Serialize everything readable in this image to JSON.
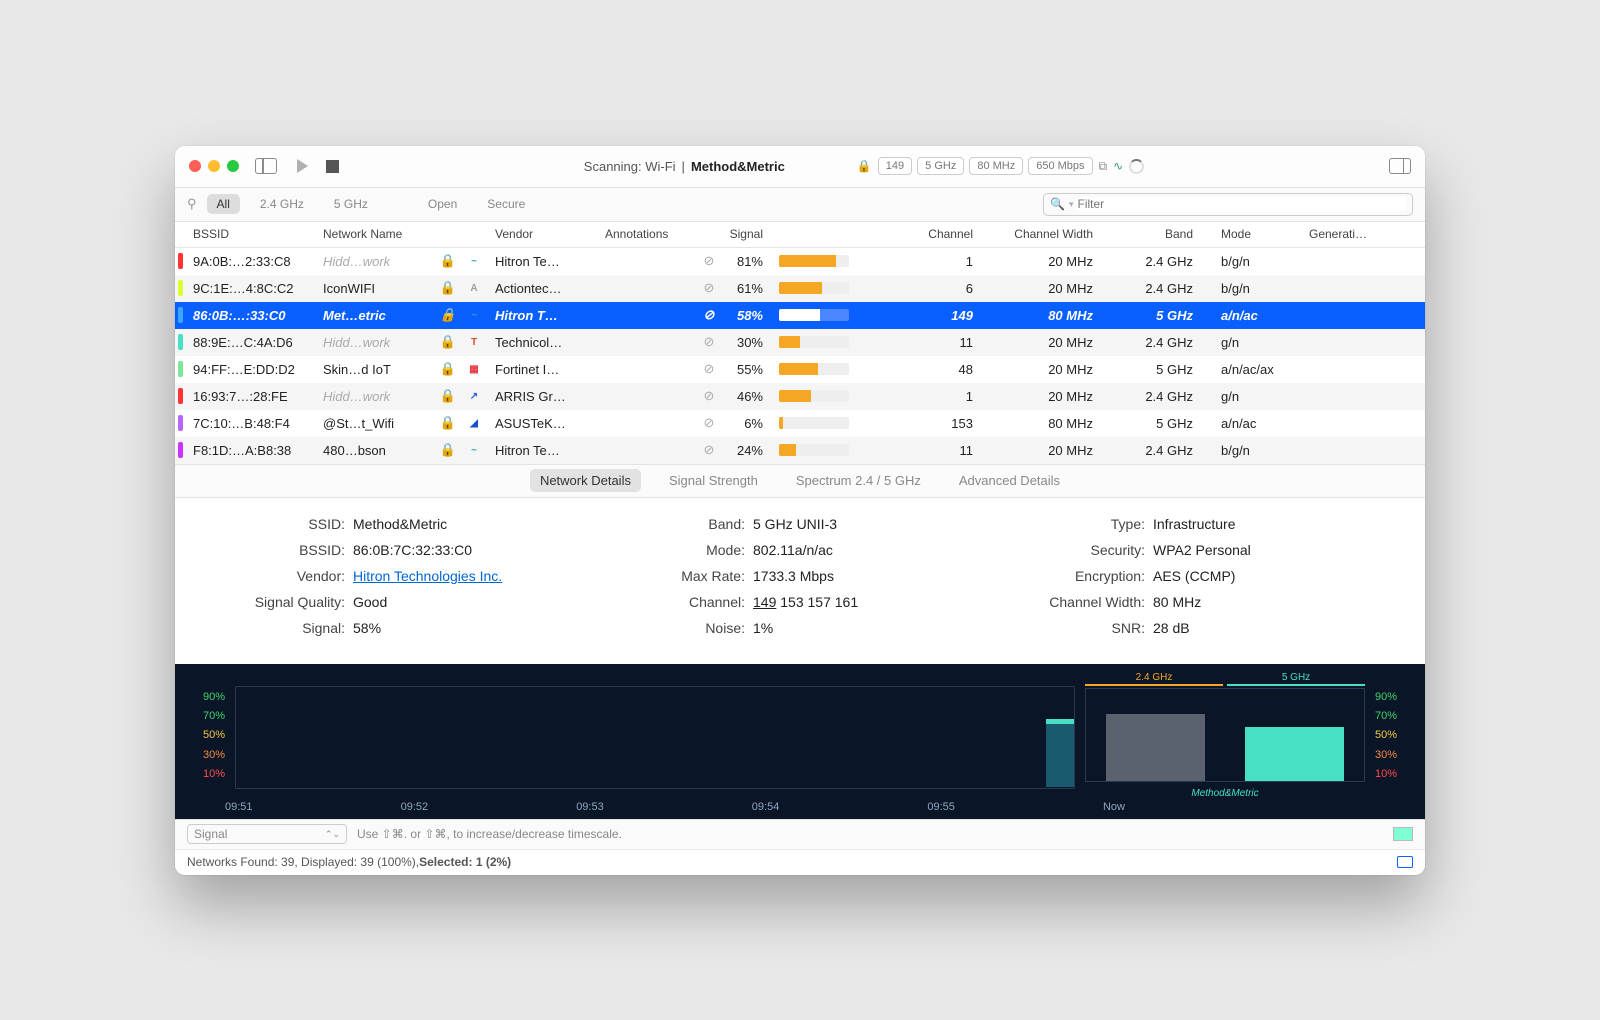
{
  "titlebar": {
    "scanning_prefix": "Scanning: Wi-Fi",
    "separator": "|",
    "network": "Method&Metric",
    "badges": {
      "channel": "149",
      "band": "5 GHz",
      "width": "80 MHz",
      "rate": "650 Mbps"
    }
  },
  "filters": {
    "all": "All",
    "g24": "2.4 GHz",
    "g5": "5 GHz",
    "open": "Open",
    "secure": "Secure",
    "placeholder": "Filter"
  },
  "columns": {
    "bssid": "BSSID",
    "name": "Network Name",
    "vendor": "Vendor",
    "ann": "Annotations",
    "signal": "Signal",
    "channel": "Channel",
    "cw": "Channel Width",
    "band": "Band",
    "mode": "Mode",
    "gen": "Generati…"
  },
  "rows": [
    {
      "color": "#ff3333",
      "bssid": "9A:0B:…2:33:C8",
      "name": "Hidd…work",
      "hidden": true,
      "vcolor": "#2aa3c9",
      "vtxt": "~",
      "vendor": "Hitron Te…",
      "signal": 81,
      "ch": "1",
      "cw": "20 MHz",
      "band": "2.4 GHz",
      "mode": "b/g/n"
    },
    {
      "color": "#d9ff33",
      "bssid": "9C:1E:…4:8C:C2",
      "name": "IconWIFI",
      "hidden": false,
      "vcolor": "#9e9e9e",
      "vtxt": "A",
      "vendor": "Actiontec…",
      "signal": 61,
      "ch": "6",
      "cw": "20 MHz",
      "band": "2.4 GHz",
      "mode": "b/g/n"
    },
    {
      "color": "#3aa8ff",
      "bssid": "86:0B:…:33:C0",
      "name": "Met…etric",
      "hidden": false,
      "vcolor": "#2aa3c9",
      "vtxt": "~",
      "vendor": "Hitron T…",
      "signal": 58,
      "ch": "149",
      "cw": "80 MHz",
      "band": "5 GHz",
      "mode": "a/n/ac",
      "selected": true
    },
    {
      "color": "#47e0c4",
      "bssid": "88:9E:…C:4A:D6",
      "name": "Hidd…work",
      "hidden": true,
      "vcolor": "#d94b2a",
      "vtxt": "T",
      "vendor": "Technicol…",
      "signal": 30,
      "ch": "11",
      "cw": "20 MHz",
      "band": "2.4 GHz",
      "mode": "g/n"
    },
    {
      "color": "#7de69a",
      "bssid": "94:FF:…E:DD:D2",
      "name": "Skin…d IoT",
      "hidden": false,
      "vcolor": "#e63946",
      "vtxt": "▦",
      "vendor": "Fortinet I…",
      "signal": 55,
      "ch": "48",
      "cw": "20 MHz",
      "band": "5 GHz",
      "mode": "a/n/ac/ax"
    },
    {
      "color": "#ff3333",
      "bssid": "16:93:7…:28:FE",
      "name": "Hidd…work",
      "hidden": true,
      "vcolor": "#2a5fd9",
      "vtxt": "↗",
      "vendor": "ARRIS Gr…",
      "signal": 46,
      "ch": "1",
      "cw": "20 MHz",
      "band": "2.4 GHz",
      "mode": "g/n"
    },
    {
      "color": "#b866ff",
      "bssid": "7C:10:…B:48:F4",
      "name": "@St…t_Wifi",
      "hidden": false,
      "vcolor": "#1a4fd1",
      "vtxt": "◢",
      "vendor": "ASUSTeK…",
      "signal": 6,
      "ch": "153",
      "cw": "80 MHz",
      "band": "5 GHz",
      "mode": "a/n/ac"
    },
    {
      "color": "#cc33ff",
      "bssid": "F8:1D:…A:B8:38",
      "name": "480…bson",
      "hidden": false,
      "vcolor": "#2aa3c9",
      "vtxt": "~",
      "vendor": "Hitron Te…",
      "signal": 24,
      "ch": "11",
      "cw": "20 MHz",
      "band": "2.4 GHz",
      "mode": "b/g/n"
    }
  ],
  "detail_tabs": {
    "nd": "Network Details",
    "ss": "Signal Strength",
    "sp": "Spectrum 2.4 / 5 GHz",
    "ad": "Advanced Details"
  },
  "details": {
    "col1": {
      "SSID": "Method&Metric",
      "BSSID": "86:0B:7C:32:33:C0",
      "Vendor": "Hitron Technologies Inc.",
      "Signal Quality": "Good",
      "Signal": "58%"
    },
    "col2": {
      "Band": "5 GHz UNII-3",
      "Mode": "802.11a/n/ac",
      "Max Rate": "1733.3 Mbps",
      "Channel_primary": "149",
      "Channel_rest": "153 157 161",
      "Noise": "1%"
    },
    "col3": {
      "Type": "Infrastructure",
      "Security": "WPA2 Personal",
      "Encryption": "AES (CCMP)",
      "Channel Width": "80 MHz",
      "SNR": "28 dB"
    }
  },
  "chart": {
    "y_ticks": [
      "90%",
      "70%",
      "50%",
      "30%",
      "10%"
    ],
    "x_ticks": [
      "09:51",
      "09:52",
      "09:53",
      "09:54",
      "09:55",
      "Now"
    ],
    "mini_header_24": "2.4 GHz",
    "mini_header_5": "5 GHz",
    "mini_label": "Method&Metric"
  },
  "bottombar": {
    "dropdown": "Signal",
    "hint": "Use ⇧⌘. or ⇧⌘, to increase/decrease timescale."
  },
  "status": {
    "text": "Networks Found: 39, Displayed: 39 (100%), ",
    "selected": "Selected: 1 (2%)"
  },
  "chart_data": {
    "type": "bar",
    "title": "Signal strength by band",
    "categories": [
      "2.4 GHz",
      "5 GHz"
    ],
    "values": [
      72,
      58
    ],
    "ylabel": "Signal %",
    "ylim": [
      0,
      100
    ],
    "timeseries": {
      "type": "line",
      "x": [
        "09:51",
        "09:52",
        "09:53",
        "09:54",
        "09:55",
        "Now"
      ],
      "values": [
        null,
        null,
        null,
        null,
        null,
        58
      ],
      "ylabel": "Signal %",
      "ylim": [
        0,
        100
      ]
    }
  }
}
